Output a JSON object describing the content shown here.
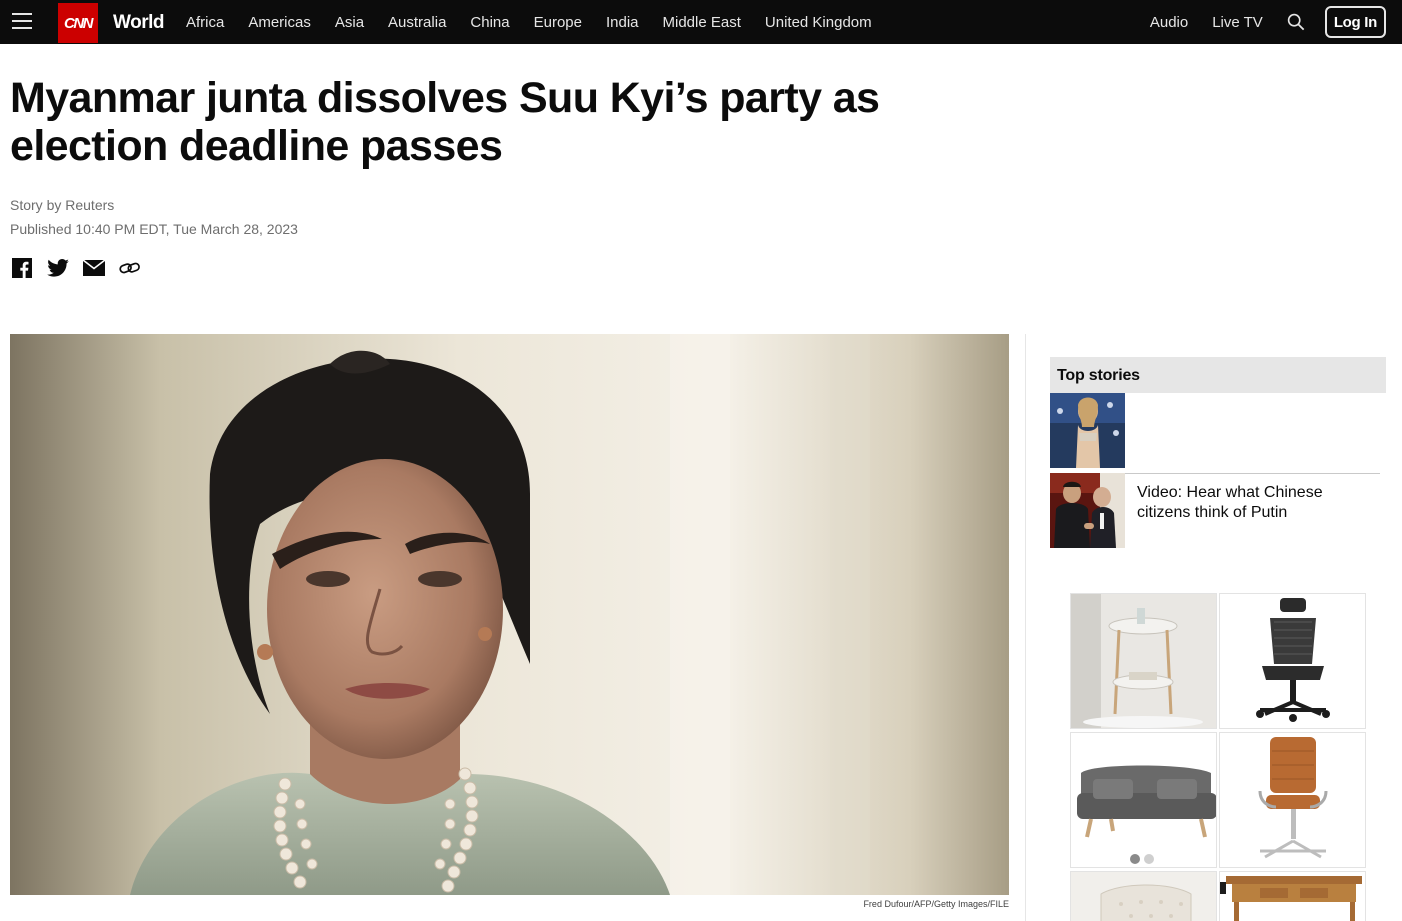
{
  "header": {
    "menu_icon": "hamburger-menu-icon",
    "logo": "CNN",
    "section": "World",
    "nav": [
      "Africa",
      "Americas",
      "Asia",
      "Australia",
      "China",
      "Europe",
      "India",
      "Middle East",
      "United Kingdom"
    ],
    "audio": "Audio",
    "live_tv": "Live TV",
    "search_icon": "search-icon",
    "login": "Log In"
  },
  "article": {
    "headline": "Myanmar junta dissolves Suu Kyi’s party as election deadline passes",
    "byline": "Story by Reuters",
    "timestamp": "Published 10:40 PM EDT, Tue March 28, 2023",
    "share_icons": [
      "facebook-icon",
      "twitter-icon",
      "email-icon",
      "link-icon"
    ],
    "image_credit": "Fred Dufour/AFP/Getty Images/FILE"
  },
  "sidebar": {
    "top_stories_label": "Top stories",
    "stories": [
      {
        "title": ""
      },
      {
        "title": "Video: Hear what Chinese citizens think of Putin"
      }
    ]
  },
  "ad": {
    "adchoices": "ⓘ ✕"
  },
  "colors": {
    "brand_red": "#cc0000",
    "topbar": "#0c0c0c",
    "meta_gray": "#6e6e6e"
  }
}
